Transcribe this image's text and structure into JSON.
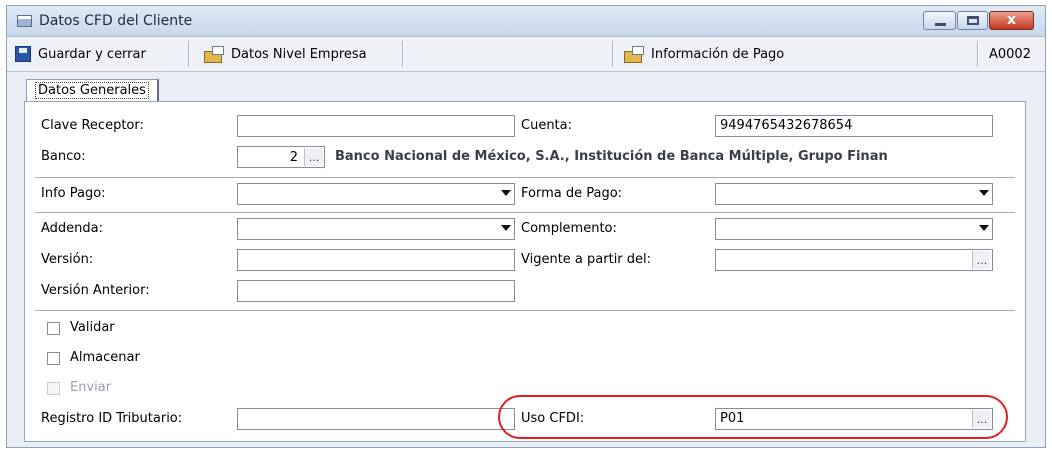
{
  "window": {
    "title": "Datos CFD del Cliente",
    "close_glyph": "x"
  },
  "toolbar": {
    "save_label": "Guardar y cerrar",
    "company_label": "Datos Nivel Empresa",
    "payment_label": "Información de Pago",
    "code": "A0002"
  },
  "tabs": [
    {
      "label": "Datos Generales"
    }
  ],
  "form": {
    "clave_receptor": {
      "label": "Clave Receptor:",
      "value": ""
    },
    "cuenta": {
      "label": "Cuenta:",
      "value": "9494765432678654"
    },
    "banco": {
      "label": "Banco:",
      "code": "2",
      "name": "Banco Nacional de México, S.A., Institución de Banca Múltiple, Grupo Finan"
    },
    "info_pago": {
      "label": "Info Pago:",
      "value": ""
    },
    "forma_pago": {
      "label": "Forma de Pago:",
      "value": ""
    },
    "addenda": {
      "label": "Addenda:",
      "value": ""
    },
    "complemento": {
      "label": "Complemento:",
      "value": ""
    },
    "version": {
      "label": "Versión:",
      "value": ""
    },
    "vigente": {
      "label": "Vigente a partir del:",
      "value": ""
    },
    "version_anterior": {
      "label": "Versión Anterior:",
      "value": ""
    },
    "validar": {
      "label": "Validar",
      "checked": false
    },
    "almacenar": {
      "label": "Almacenar",
      "checked": false
    },
    "enviar": {
      "label": "Enviar",
      "checked": false,
      "disabled": true
    },
    "registro_id": {
      "label": "Registro ID Tributario:",
      "value": ""
    },
    "uso_cfdi": {
      "label": "Uso CFDI:",
      "value": "P01"
    },
    "ellipsis": "..."
  },
  "colors": {
    "highlight_oval": "#e01f1f",
    "window_bg": "#e9edf4"
  }
}
